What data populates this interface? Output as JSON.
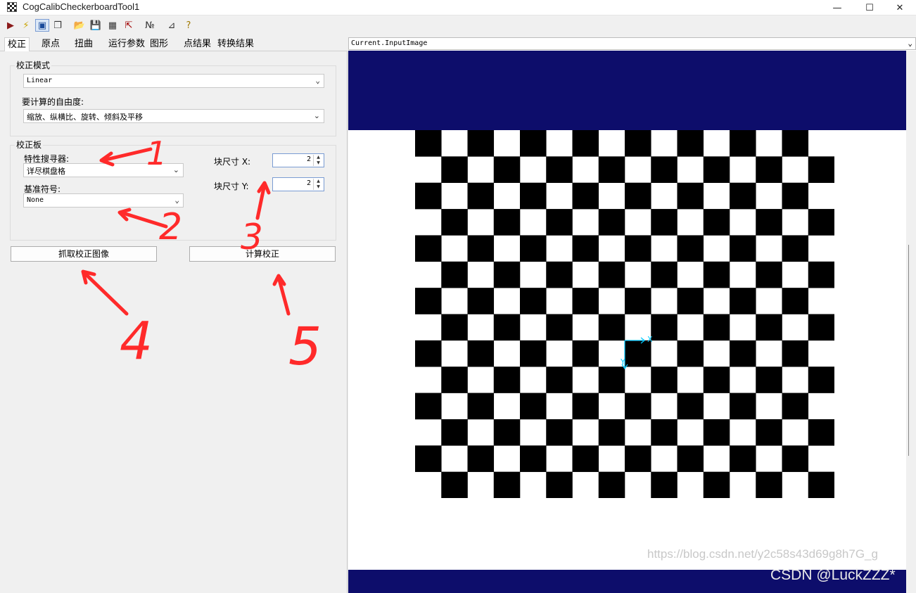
{
  "window": {
    "title": "CogCalibCheckerboardTool1",
    "minimize": "—",
    "maximize": "☐",
    "close": "✕"
  },
  "toolbar": {
    "items": [
      {
        "icon": "run-icon",
        "glyph": "▶",
        "color": "#8b1a1a"
      },
      {
        "icon": "lightning-icon",
        "glyph": "⚡",
        "color": "#c9a400"
      },
      {
        "icon": "image-display-icon",
        "glyph": "▣",
        "color": "#1a4a9a"
      },
      {
        "icon": "windows-icon",
        "glyph": "❐",
        "color": "#333333"
      },
      {
        "icon": "open-folder-icon",
        "glyph": "📂",
        "color": "#c99a2e"
      },
      {
        "icon": "save-icon",
        "glyph": "💾",
        "color": "#333333"
      },
      {
        "icon": "settings-grid-icon",
        "glyph": "▦",
        "color": "#333333"
      },
      {
        "icon": "import-icon",
        "glyph": "⇱",
        "color": "#a00000"
      },
      {
        "icon": "numeric-icon",
        "glyph": "№",
        "color": "#333333"
      },
      {
        "icon": "ruler-icon",
        "glyph": "⊿",
        "color": "#333333"
      },
      {
        "icon": "help-icon",
        "glyph": "?",
        "color": "#a07800"
      }
    ]
  },
  "tabs": [
    {
      "label": "校正",
      "active": true
    },
    {
      "label": "原点",
      "active": false
    },
    {
      "label": "扭曲",
      "active": false
    },
    {
      "label": "运行参数",
      "active": false
    },
    {
      "label": "图形",
      "active": false
    },
    {
      "label": "点结果",
      "active": false
    },
    {
      "label": "转换结果",
      "active": false
    }
  ],
  "calibration_mode": {
    "group_title": "校正模式",
    "mode_value": "Linear",
    "dof_label": "要计算的自由度:",
    "dof_value": "缩放、纵横比、旋转、倾斜及平移"
  },
  "calibration_plate": {
    "group_title": "校正板",
    "feature_finder_label": "特性搜寻器:",
    "feature_finder_value": "详尽棋盘格",
    "fiducial_label": "基准符号:",
    "fiducial_value": "None",
    "tile_size_x_label": "块尺寸 X:",
    "tile_size_x_value": "2",
    "tile_size_y_label": "块尺寸 Y:",
    "tile_size_y_value": "2"
  },
  "buttons": {
    "grab_label": "抓取校正图像",
    "compute_label": "计算校正"
  },
  "viewer": {
    "image_selector_value": "Current.InputImage",
    "axis_x_label": "X",
    "axis_y_label": "Y"
  },
  "annotations": {
    "markers": [
      "1",
      "2",
      "3",
      "4",
      "5"
    ],
    "color": "#ff2a2a"
  },
  "watermarks": {
    "url": "https://blog.csdn.net/y2c58s43d69g8h7G_g",
    "author": "CSDN @LuckZZZ*"
  },
  "colors": {
    "image_band": "#0d0d6b",
    "checker_dark": "#000000",
    "checker_light": "#ffffff",
    "axis_graphic": "#00c8ff"
  }
}
